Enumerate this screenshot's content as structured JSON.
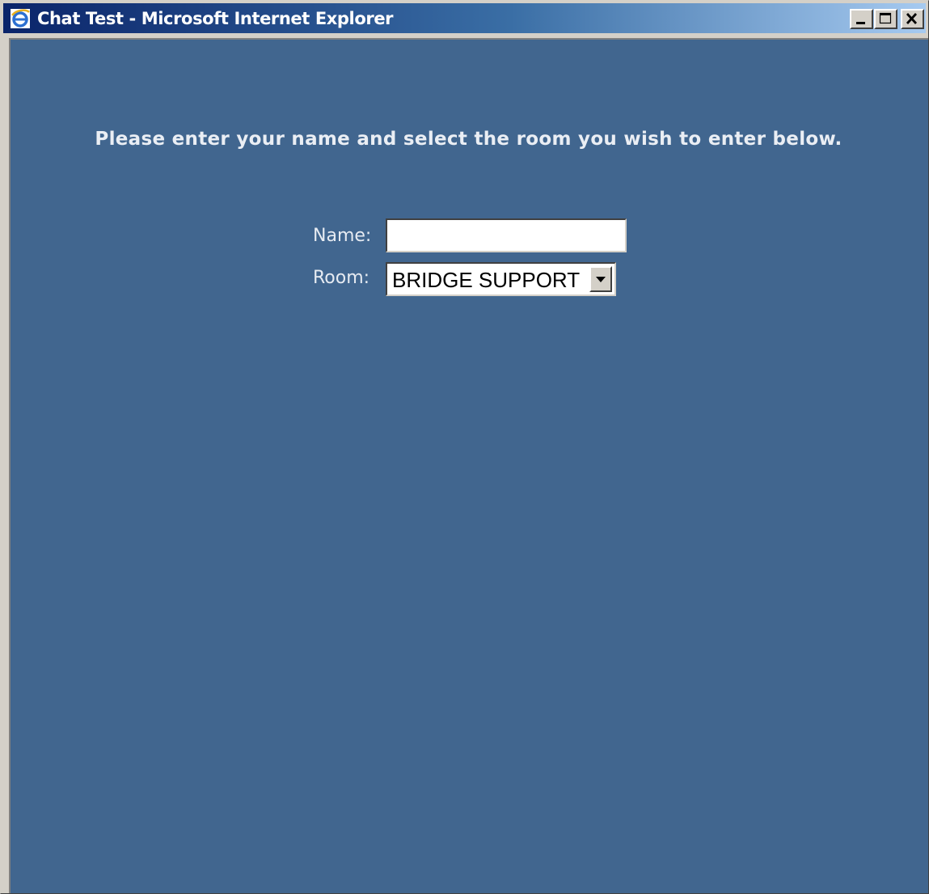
{
  "window": {
    "title": "Chat Test - Microsoft Internet Explorer",
    "icon": "internet-explorer-icon",
    "controls": [
      "minimize-icon",
      "maximize-icon",
      "close-icon"
    ]
  },
  "page": {
    "instruction": "Please enter your name and select the room you wish to enter below.",
    "background_color": "#41668f"
  },
  "form": {
    "name_label": "Name:",
    "name_value": "",
    "room_label": "Room:",
    "room_selected": "BRIDGE SUPPORT"
  }
}
